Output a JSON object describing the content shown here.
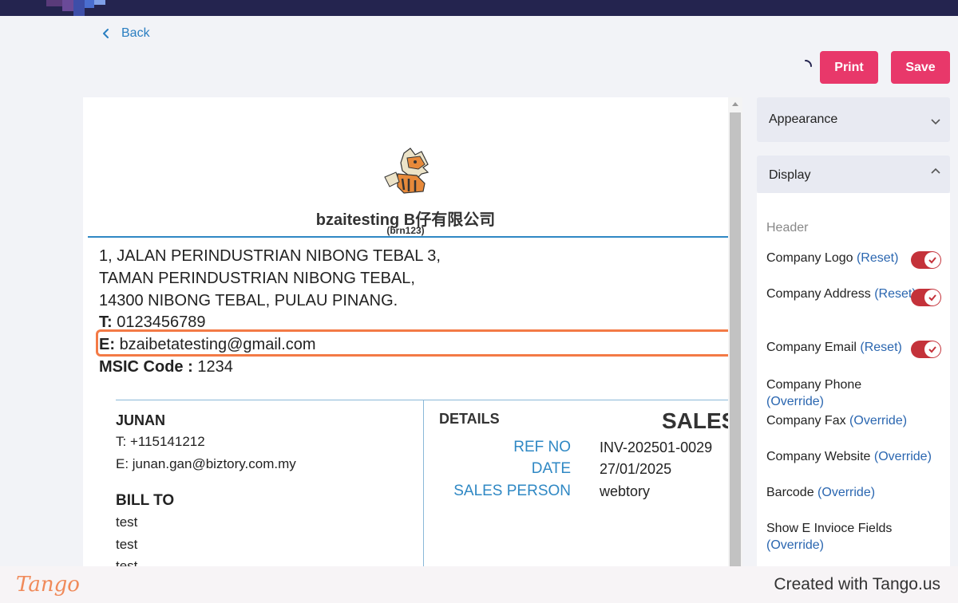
{
  "header": {
    "back_label": "Back",
    "print_label": "Print",
    "save_label": "Save"
  },
  "document": {
    "company_name": "bzaitesting B仔有限公司",
    "brn": "(brn123)",
    "address_lines": [
      "1, JALAN PERINDUSTRIAN NIBONG TEBAL 3,",
      "TAMAN PERINDUSTRIAN NIBONG TEBAL,",
      "14300 NIBONG TEBAL, PULAU PINANG."
    ],
    "phone_label": "T:",
    "phone": "0123456789",
    "email_label": "E:",
    "email": "bzaibetatesting@gmail.com",
    "msic_label": "MSIC Code :",
    "msic": "1234",
    "customer": {
      "name": "JUNAN",
      "phone": "T: +115141212",
      "email": "E: junan.gan@biztory.com.my"
    },
    "bill_to": {
      "heading": "BILL TO",
      "lines": [
        "test",
        "test",
        "test"
      ]
    },
    "details": {
      "heading": "DETAILS",
      "doc_title": "SALES",
      "rows": [
        {
          "label": "REF NO",
          "value": "INV-202501-0029"
        },
        {
          "label": "DATE",
          "value": "27/01/2025"
        },
        {
          "label": "SALES PERSON",
          "value": "webtory"
        }
      ]
    }
  },
  "sidebar": {
    "appearance_title": "Appearance",
    "display_title": "Display",
    "header_section": "Header",
    "options": [
      {
        "label": "Company Logo",
        "action": "(Reset)"
      },
      {
        "label": "Company Address",
        "action": "(Reset)"
      },
      {
        "label": "Company Email",
        "action": "(Reset)"
      },
      {
        "label": "Company Phone",
        "action": "(Override)"
      },
      {
        "label": "Company Fax",
        "action": "(Override)"
      },
      {
        "label": "Company Website",
        "action": "(Override)"
      },
      {
        "label": "Barcode",
        "action": "(Override)"
      },
      {
        "label": "Show E Invioce Fields",
        "action": "(Override)"
      }
    ]
  },
  "footer": {
    "brand": "Tango",
    "created": "Created with Tango.us"
  },
  "colors": {
    "accent": "#e8386a",
    "link": "#2a7ec1",
    "highlight": "#f37a46",
    "toggle_on": "#c4323a"
  }
}
